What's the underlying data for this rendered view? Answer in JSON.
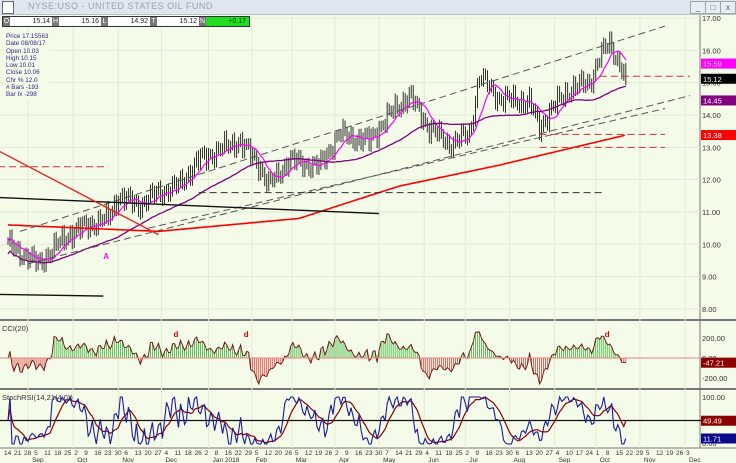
{
  "window": {
    "title": "NYSE:USO - UNITED STATES OIL FUND",
    "buttons": [
      "_",
      "□",
      "x"
    ]
  },
  "quote_bar": {
    "O": "15.14",
    "H": "15.16",
    "L": "14.92",
    "T": "15.12",
    "change": "+0.17"
  },
  "info_box": [
    "Price 17.15563",
    "Date 08/08/17",
    "Open 10.03",
    "High 10.15",
    "Low 10.01",
    "Close 10.06",
    "Chr % 12.0",
    "# Bars -193",
    "Bar Ix -298"
  ],
  "colors": {
    "bg": "#f4fbe8",
    "ma20": "#ff00ff",
    "ma50": "#800080",
    "ma200": "#ff0000",
    "cci_pos": "#22aa22",
    "cci_neg": "#dd2222",
    "stoch": "#1a1a9a",
    "signal": "#8b0000"
  },
  "chart_data": {
    "type": "line",
    "title": "USO daily OHLC with moving averages",
    "x_unit": "weeks since 2017-08-14",
    "price_key_closes": [
      [
        0,
        10.0
      ],
      [
        2,
        9.6
      ],
      [
        3,
        9.4
      ],
      [
        6,
        10.3
      ],
      [
        8,
        10.6
      ],
      [
        10,
        10.8
      ],
      [
        11,
        11.5
      ],
      [
        13,
        11.2
      ],
      [
        15,
        11.6
      ],
      [
        17,
        11.8
      ],
      [
        19,
        12.6
      ],
      [
        23,
        13.2
      ],
      [
        25,
        12.5
      ],
      [
        26,
        11.8
      ],
      [
        28,
        12.6
      ],
      [
        31,
        12.4
      ],
      [
        33,
        13.4
      ],
      [
        36,
        13.2
      ],
      [
        38,
        14.0
      ],
      [
        40,
        14.6
      ],
      [
        42,
        13.6
      ],
      [
        44,
        13.1
      ],
      [
        46,
        13.4
      ],
      [
        47,
        15.2
      ],
      [
        49,
        14.5
      ],
      [
        52,
        14.4
      ],
      [
        53,
        13.6
      ],
      [
        54,
        14.1
      ],
      [
        56,
        14.8
      ],
      [
        58,
        15.0
      ],
      [
        59,
        15.8
      ],
      [
        60,
        16.2
      ],
      [
        61,
        15.6
      ],
      [
        61.6,
        15.12
      ]
    ],
    "ma200_key": [
      [
        0,
        10.6
      ],
      [
        15,
        10.4
      ],
      [
        29,
        10.8
      ],
      [
        39,
        11.8
      ],
      [
        49,
        12.45
      ],
      [
        61.6,
        13.38
      ]
    ],
    "annotations": [
      {
        "type": "dashed",
        "color": "#555",
        "p": [
          [
            1.2,
            10.4
          ],
          [
            65.5,
            16.75
          ]
        ]
      },
      {
        "type": "dashed",
        "color": "#555",
        "p": [
          [
            2,
            9.4
          ],
          [
            68,
            14.6
          ]
        ]
      },
      {
        "type": "dashed",
        "color": "#555",
        "p": [
          [
            14,
            10.5
          ],
          [
            65.5,
            14.2
          ]
        ]
      },
      {
        "type": "dashed",
        "color": "#cc3333",
        "p": [
          [
            -1,
            12.4
          ],
          [
            10,
            12.4
          ]
        ]
      },
      {
        "type": "dashed",
        "color": "#cc3333",
        "p": [
          [
            53,
            13.4
          ],
          [
            65.5,
            13.4
          ]
        ]
      },
      {
        "type": "dashed",
        "color": "#cc3333",
        "p": [
          [
            53,
            13.0
          ],
          [
            65.5,
            13.0
          ]
        ]
      },
      {
        "type": "dashed",
        "color": "#cc3333",
        "p": [
          [
            59,
            15.2
          ],
          [
            68,
            15.2
          ]
        ]
      },
      {
        "type": "dashed",
        "color": "#333",
        "p": [
          [
            19,
            11.6
          ],
          [
            59.5,
            11.6
          ]
        ]
      },
      {
        "type": "solid",
        "color": "#111",
        "p": [
          [
            -1,
            11.45
          ],
          [
            37,
            10.95
          ]
        ]
      },
      {
        "type": "solid",
        "color": "#111",
        "p": [
          [
            -1,
            8.45
          ],
          [
            9.5,
            8.4
          ]
        ]
      },
      {
        "type": "solid",
        "color": "#ee2222",
        "p": [
          [
            -1,
            12.9
          ],
          [
            15,
            10.3
          ]
        ]
      }
    ],
    "y_ticks": [
      "17.00",
      "16.00",
      "15.00",
      "14.00",
      "13.00",
      "12.00",
      "11.00",
      "10.00",
      "9.00",
      "8.00"
    ],
    "ylim": [
      8,
      17
    ],
    "price_tags": [
      {
        "v": "15.59",
        "c": "#ff00ff",
        "p": 15.59
      },
      {
        "v": "15.12",
        "c": "#000000",
        "p": 15.12
      },
      {
        "v": "14.45",
        "c": "#800080",
        "p": 14.45
      },
      {
        "v": "13.38",
        "c": "#ff0000",
        "p": 13.38
      }
    ],
    "cci": {
      "label": "CCI(20)",
      "ticks": [
        "200.00",
        "0.00",
        "-200.00"
      ],
      "last": "-47.21"
    },
    "stochrsi": {
      "label": "StochRSI(14,21(4,0))",
      "ticks": [
        "100.00",
        "0.00"
      ],
      "last_signal": "49.49",
      "last": "11.71"
    },
    "x_ticks": [
      "14",
      "21",
      "28",
      "5",
      "11",
      "18",
      "25",
      "2",
      "9",
      "16",
      "23",
      "30",
      "6",
      "13",
      "20",
      "27",
      "4",
      "11",
      "18",
      "26",
      "2",
      "8",
      "16",
      "22",
      "29",
      "5",
      "12",
      "20",
      "26",
      "5",
      "12",
      "19",
      "26",
      "2",
      "9",
      "16",
      "23",
      "30",
      "7",
      "14",
      "21",
      "29",
      "4",
      "11",
      "18",
      "25",
      "2",
      "9",
      "16",
      "23",
      "30",
      "6",
      "13",
      "20",
      "27",
      "4",
      "10",
      "17",
      "24",
      "1",
      "8",
      "15",
      "22",
      "29",
      "5",
      "12",
      "19",
      "26",
      "3"
    ],
    "months": [
      [
        "Sep",
        3
      ],
      [
        "Oct",
        7.5
      ],
      [
        "Nov",
        12
      ],
      [
        "Dec",
        16.3
      ],
      [
        "Jan 2018",
        21
      ],
      [
        "Feb",
        25.3
      ],
      [
        "Mar",
        29.3
      ],
      [
        "Apr",
        33.6
      ],
      [
        "May",
        38
      ],
      [
        "Jun",
        42.5
      ],
      [
        "Jul",
        46.6
      ],
      [
        "Aug",
        51
      ],
      [
        "Sep",
        55.5
      ],
      [
        "Oct",
        59.6
      ],
      [
        "Nov",
        64
      ],
      [
        "Dec",
        68.5
      ]
    ],
    "markers": [
      {
        "t": "A",
        "c": "#ff00ff",
        "w": 9.5,
        "p": 9.55
      },
      {
        "t": "d",
        "c": "#dd0000",
        "pane": "cci",
        "w": 16.5
      },
      {
        "t": "d",
        "c": "#dd0000",
        "pane": "cci",
        "w": 23.5
      },
      {
        "t": "d",
        "c": "#dd0000",
        "pane": "cci",
        "w": 59.5
      }
    ]
  }
}
